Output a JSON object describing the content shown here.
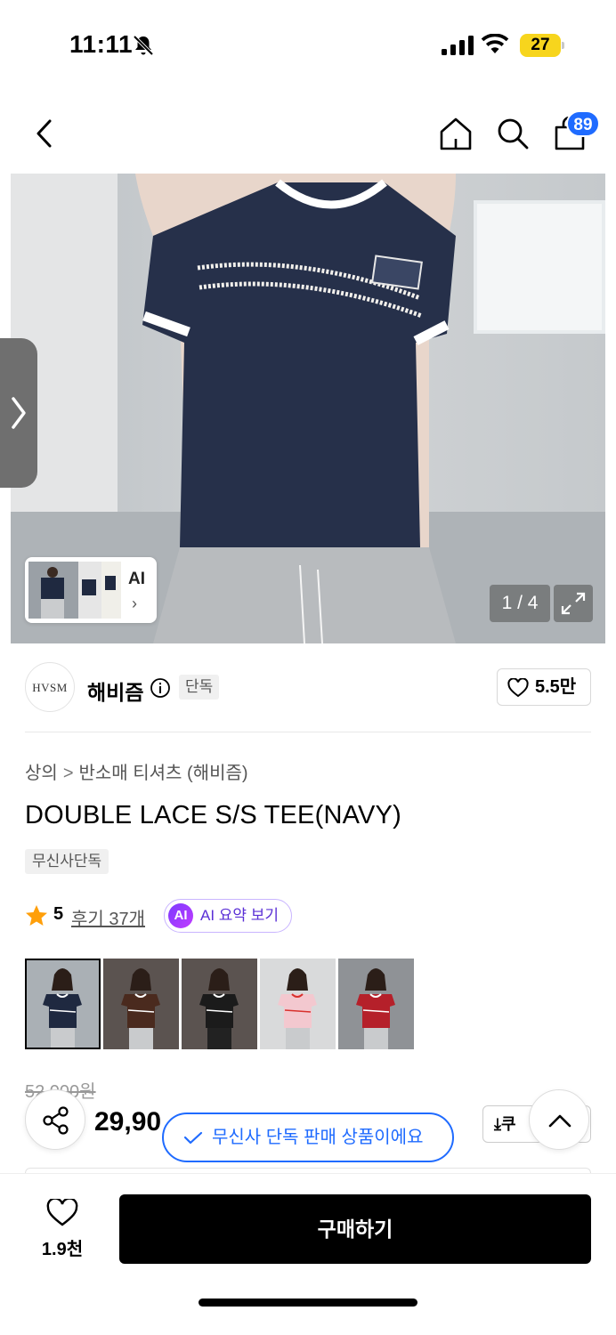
{
  "status_bar": {
    "time": "11:11",
    "battery": "27"
  },
  "nav": {
    "cart_count": "89"
  },
  "gallery": {
    "pager": "1 / 4",
    "ai_label": "AI",
    "ai_chevron": "›"
  },
  "brand": {
    "logo_text": "HVSM",
    "name": "해비즘",
    "tag": "단독",
    "likes": "5.5만"
  },
  "breadcrumb": {
    "category": "상의",
    "separator": ">",
    "subcategory": "반소매 티셔츠 (해비즘)"
  },
  "product": {
    "title": "DOUBLE LACE S/S TEE(NAVY)",
    "exclusive_tag": "무신사단독",
    "rating": "5",
    "reviews": "후기 37개",
    "ai_badge": "AI",
    "ai_summary": "AI 요약 보기"
  },
  "color_thumbs": [
    {
      "name": "navy",
      "shirt": "#1f2940",
      "trim": "#ffffff",
      "selected": true
    },
    {
      "name": "brown",
      "shirt": "#4a2a1e",
      "trim": "#ffffff",
      "selected": false
    },
    {
      "name": "black",
      "shirt": "#1b1b1b",
      "trim": "#ffffff",
      "selected": false
    },
    {
      "name": "pink",
      "shirt": "#f3c8cf",
      "trim": "#d8312d",
      "selected": false
    },
    {
      "name": "red",
      "shirt": "#b5202a",
      "trim": "#ffffff",
      "selected": false
    }
  ],
  "price": {
    "original": "52,000원",
    "sale": "29,90",
    "coupon": "⤓쿠"
  },
  "toast": {
    "text": "무신사 단독 판매 상품이에요"
  },
  "bottom": {
    "wish_count": "1.9천",
    "buy_label": "구매하기"
  },
  "colors": {
    "accent": "#1f6bff",
    "star": "#ff9f0a",
    "ai": "#7b3bff"
  }
}
